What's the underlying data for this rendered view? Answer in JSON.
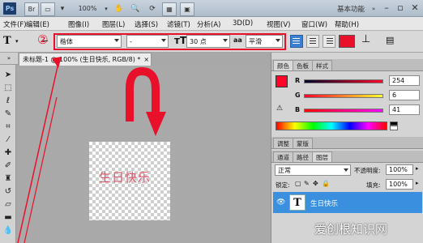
{
  "titlebar": {
    "logo": "Ps",
    "zoom": "100%",
    "workspace": "基本功能",
    "icons": [
      "hand-icon",
      "zoom-icon",
      "rotate-icon",
      "arrange-icon",
      "screen-mode-icon"
    ]
  },
  "menu": {
    "items": [
      "文件(F)",
      "编辑(E)",
      "图像(I)",
      "图层(L)",
      "选择(S)",
      "滤镜(T)",
      "分析(A)",
      "3D(D)",
      "视图(V)",
      "窗口(W)",
      "帮助(H)"
    ]
  },
  "options": {
    "tool_glyph": "T",
    "marker": "②",
    "font_family": "楷体",
    "font_style": "-",
    "font_size": "30 点",
    "aa_prefix": "aa",
    "antialias": "平滑",
    "color": "#e8102a"
  },
  "document": {
    "tab_title": "未标题-1 @ 100% (生日快乐, RGB/8) *",
    "canvas_text": "生日快乐",
    "canvas_text_color": "#e2556a"
  },
  "annotation": {
    "color": "#e8102a"
  },
  "color_panel": {
    "tabs": [
      "颜色",
      "色板",
      "样式"
    ],
    "channels": [
      {
        "label": "R",
        "value": "254"
      },
      {
        "label": "G",
        "value": "6"
      },
      {
        "label": "B",
        "value": "41"
      }
    ],
    "foreground": "#fe0629"
  },
  "adjust_panel": {
    "tabs": [
      "调整",
      "蒙版"
    ]
  },
  "layers_panel": {
    "tabs": [
      "通道",
      "路径",
      "图层"
    ],
    "blend_mode": "正常",
    "opacity_label": "不透明度:",
    "opacity_value": "100%",
    "lock_label": "锁定:",
    "fill_label": "填充:",
    "fill_value": "100%",
    "layer_thumb": "T",
    "layer_name": "生日快乐"
  },
  "watermark": "爱创根知识网"
}
